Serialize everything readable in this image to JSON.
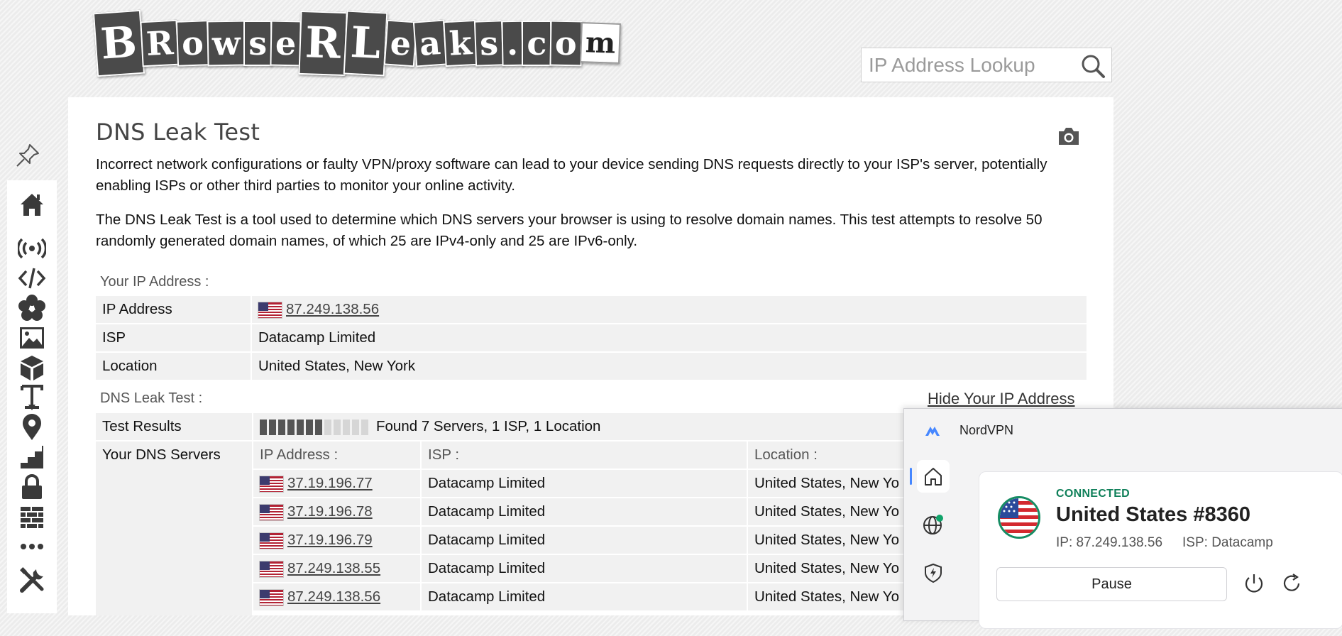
{
  "logo": {
    "letters": [
      "B",
      "R",
      "o",
      "w",
      "s",
      "e",
      "R",
      "L",
      "e",
      "a",
      "k",
      "s",
      ".",
      "c",
      "o",
      "m"
    ],
    "alt": "BrowserLeaks.com"
  },
  "search": {
    "placeholder": "IP Address Lookup",
    "icon": "search-icon"
  },
  "sidebar": {
    "items": [
      {
        "name": "home",
        "icon": "home-icon"
      },
      {
        "name": "wifi",
        "icon": "broadcast-icon"
      },
      {
        "name": "code",
        "icon": "code-icon"
      },
      {
        "name": "flower",
        "icon": "flower-icon"
      },
      {
        "name": "image",
        "icon": "image-icon"
      },
      {
        "name": "cube",
        "icon": "cube-icon"
      },
      {
        "name": "text",
        "icon": "text-cursor-icon"
      },
      {
        "name": "location",
        "icon": "location-pin-icon"
      },
      {
        "name": "stairs",
        "icon": "stairs-icon"
      },
      {
        "name": "lock",
        "icon": "lock-icon"
      },
      {
        "name": "firewall",
        "icon": "brick-wall-icon"
      },
      {
        "name": "more",
        "icon": "more-dots-icon"
      },
      {
        "name": "tools",
        "icon": "tools-icon"
      }
    ]
  },
  "page": {
    "title": "DNS Leak Test",
    "intro1": "Incorrect network configurations or faulty VPN/proxy software can lead to your device sending DNS requests directly to your ISP's server, potentially enabling ISPs or other third parties to monitor your online activity.",
    "intro2": "The DNS Leak Test is a tool used to determine which DNS servers your browser is using to resolve domain names. This test attempts to resolve 50 randomly generated domain names, of which 25 are IPv4-only and 25 are IPv6-only."
  },
  "your_ip": {
    "section_label": "Your IP Address :",
    "rows": [
      {
        "key": "IP Address",
        "value": "87.249.138.56",
        "is_link": true
      },
      {
        "key": "ISP",
        "value": "Datacamp Limited"
      },
      {
        "key": "Location",
        "value": "United States, New York"
      }
    ]
  },
  "dns_test": {
    "section_label": "DNS Leak Test :",
    "hide_link": "Hide Your IP Address",
    "results_label": "Test Results",
    "results_text": "Found 7 Servers, 1 ISP, 1 Location",
    "progress_filled": 7,
    "progress_total": 12,
    "servers_label": "Your DNS Servers",
    "col_headers": {
      "ip": "IP Address :",
      "isp": "ISP :",
      "loc": "Location :"
    },
    "servers": [
      {
        "ip": "37.19.196.77",
        "isp": "Datacamp Limited",
        "loc": "United States, New Yo"
      },
      {
        "ip": "37.19.196.78",
        "isp": "Datacamp Limited",
        "loc": "United States, New Yo"
      },
      {
        "ip": "37.19.196.79",
        "isp": "Datacamp Limited",
        "loc": "United States, New Yo"
      },
      {
        "ip": "87.249.138.55",
        "isp": "Datacamp Limited",
        "loc": "United States, New Yo"
      },
      {
        "ip": "87.249.138.56",
        "isp": "Datacamp Limited",
        "loc": "United States, New Yo"
      }
    ]
  },
  "nordvpn": {
    "app_name": "NordVPN",
    "status": "CONNECTED",
    "server": "United States #8360",
    "ip_text": "IP: 87.249.138.56",
    "isp_text": "ISP: Datacamp",
    "pause_label": "Pause",
    "accent": "#4687ff",
    "connected_color": "#10805a"
  },
  "colors": {
    "row_bg": "#f1f1f1",
    "bar_filled": "#555555",
    "bar_empty": "#d6d6d6"
  }
}
